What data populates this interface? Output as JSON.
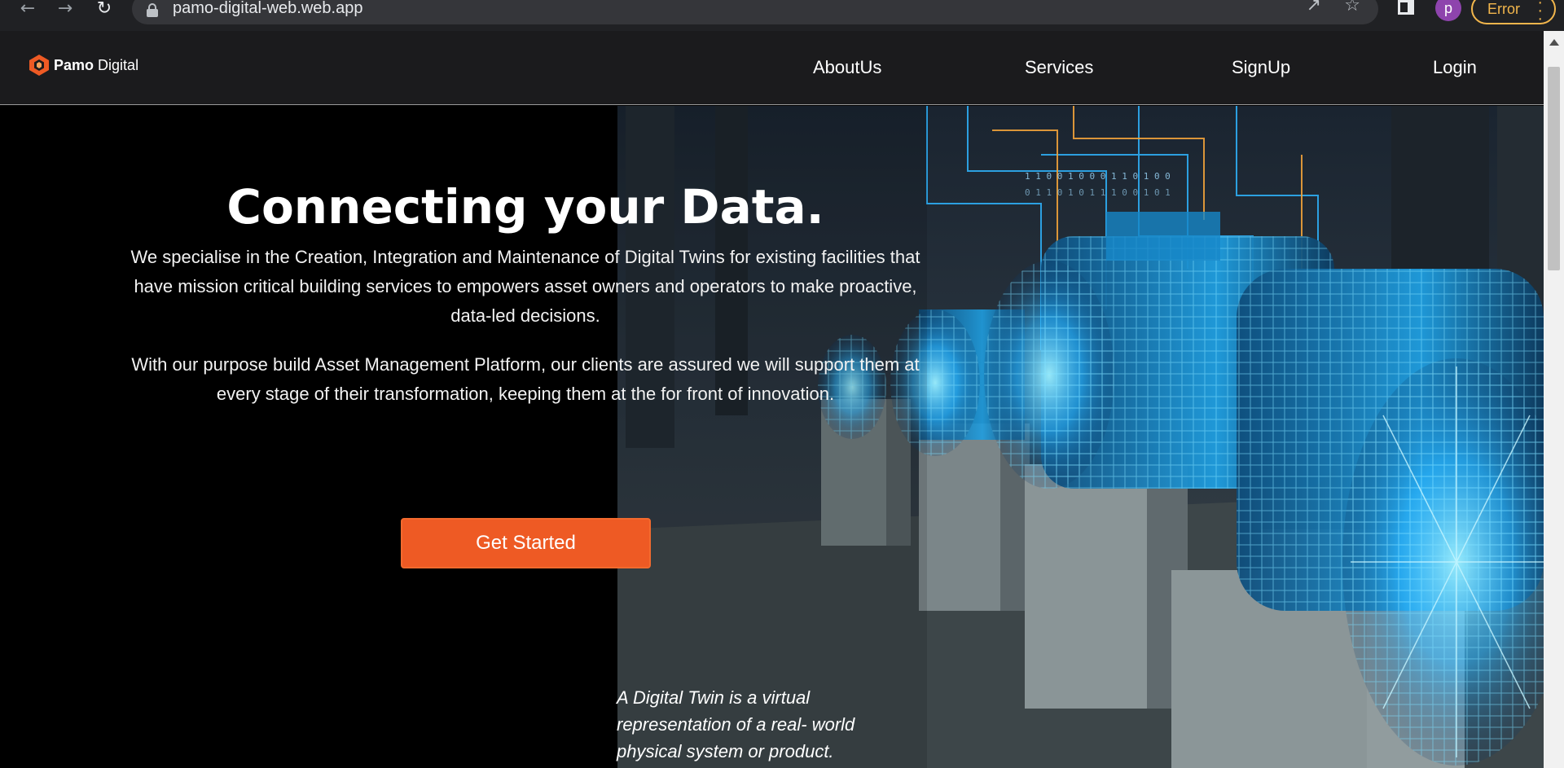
{
  "browser": {
    "url": "pamo-digital-web.web.app",
    "profile_initial": "p",
    "error_label": "Error",
    "icons": [
      "back-icon",
      "forward-icon",
      "reload-icon",
      "lock-icon",
      "share-icon",
      "star-icon",
      "sidebar-icon",
      "more-icon"
    ]
  },
  "site": {
    "logo_text_bold": "Pamo",
    "logo_text_regular": "Digital",
    "nav": [
      {
        "label": "AboutUs"
      },
      {
        "label": "Services"
      },
      {
        "label": "SignUp"
      },
      {
        "label": "Login"
      }
    ]
  },
  "hero": {
    "headline": "Connecting your Data.",
    "paragraph1": "We specialise in the Creation, Integration and Maintenance of Digital Twins for existing facilities that have mission critical building services to empowers asset owners and operators to make proactive, data-led decisions.",
    "paragraph2": "With our purpose build Asset Management Platform, our clients are assured we will support them at every stage of their transformation, keeping them at the for front of innovation.",
    "cta_label": "Get Started",
    "caption": "A Digital Twin is a virtual representation of a real- world physical system or product."
  },
  "colors": {
    "accent": "#ee5a24",
    "header_bg": "#1b1b1d",
    "hero_bg": "#000000",
    "twin_glow": "#3ad0ff"
  }
}
